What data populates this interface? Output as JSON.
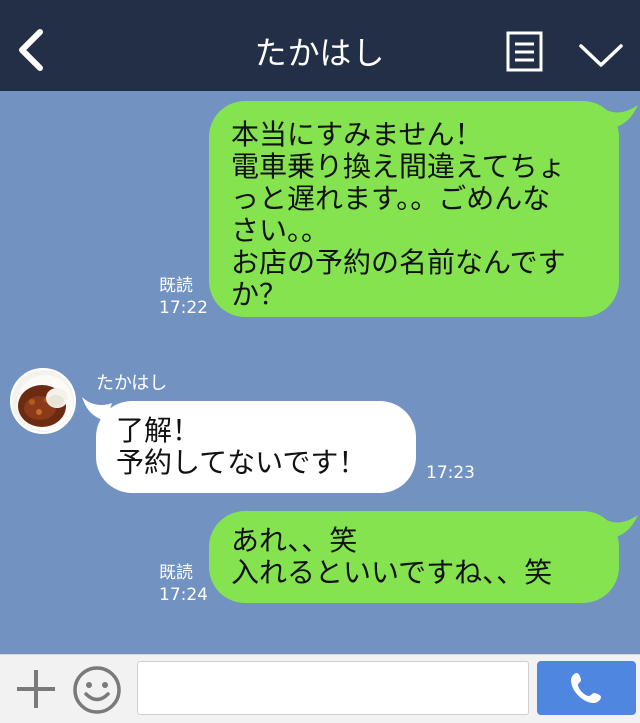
{
  "header": {
    "title": "たかはし",
    "back_icon": "chevron-left-icon",
    "menu_icon": "menu-list-icon",
    "collapse_icon": "chevron-down-icon"
  },
  "messages": [
    {
      "direction": "outgoing",
      "text": "本当にすみません！\n電車乗り換え間違えてちょ\nっと遅れます。。ごめんな\nさい。。\nお店の予約の名前なんです\nか？",
      "read_label": "既読",
      "time": "17:22"
    },
    {
      "direction": "incoming",
      "sender": "たかはし",
      "text": "了解！\n予約してないです！",
      "time": "17:23"
    },
    {
      "direction": "outgoing",
      "text": "あれ、、笑\n入れるといいですね、、笑",
      "read_label": "既読",
      "time": "17:24"
    }
  ],
  "input_bar": {
    "plus_icon": "plus-icon",
    "sticker_icon": "smiley-icon",
    "message_value": "",
    "call_icon": "phone-icon"
  },
  "colors": {
    "header_bg": "#232f47",
    "chat_bg": "#7292c2",
    "outgoing_bubble": "#84e34e",
    "incoming_bubble": "#ffffff",
    "call_button": "#4f86e0"
  }
}
